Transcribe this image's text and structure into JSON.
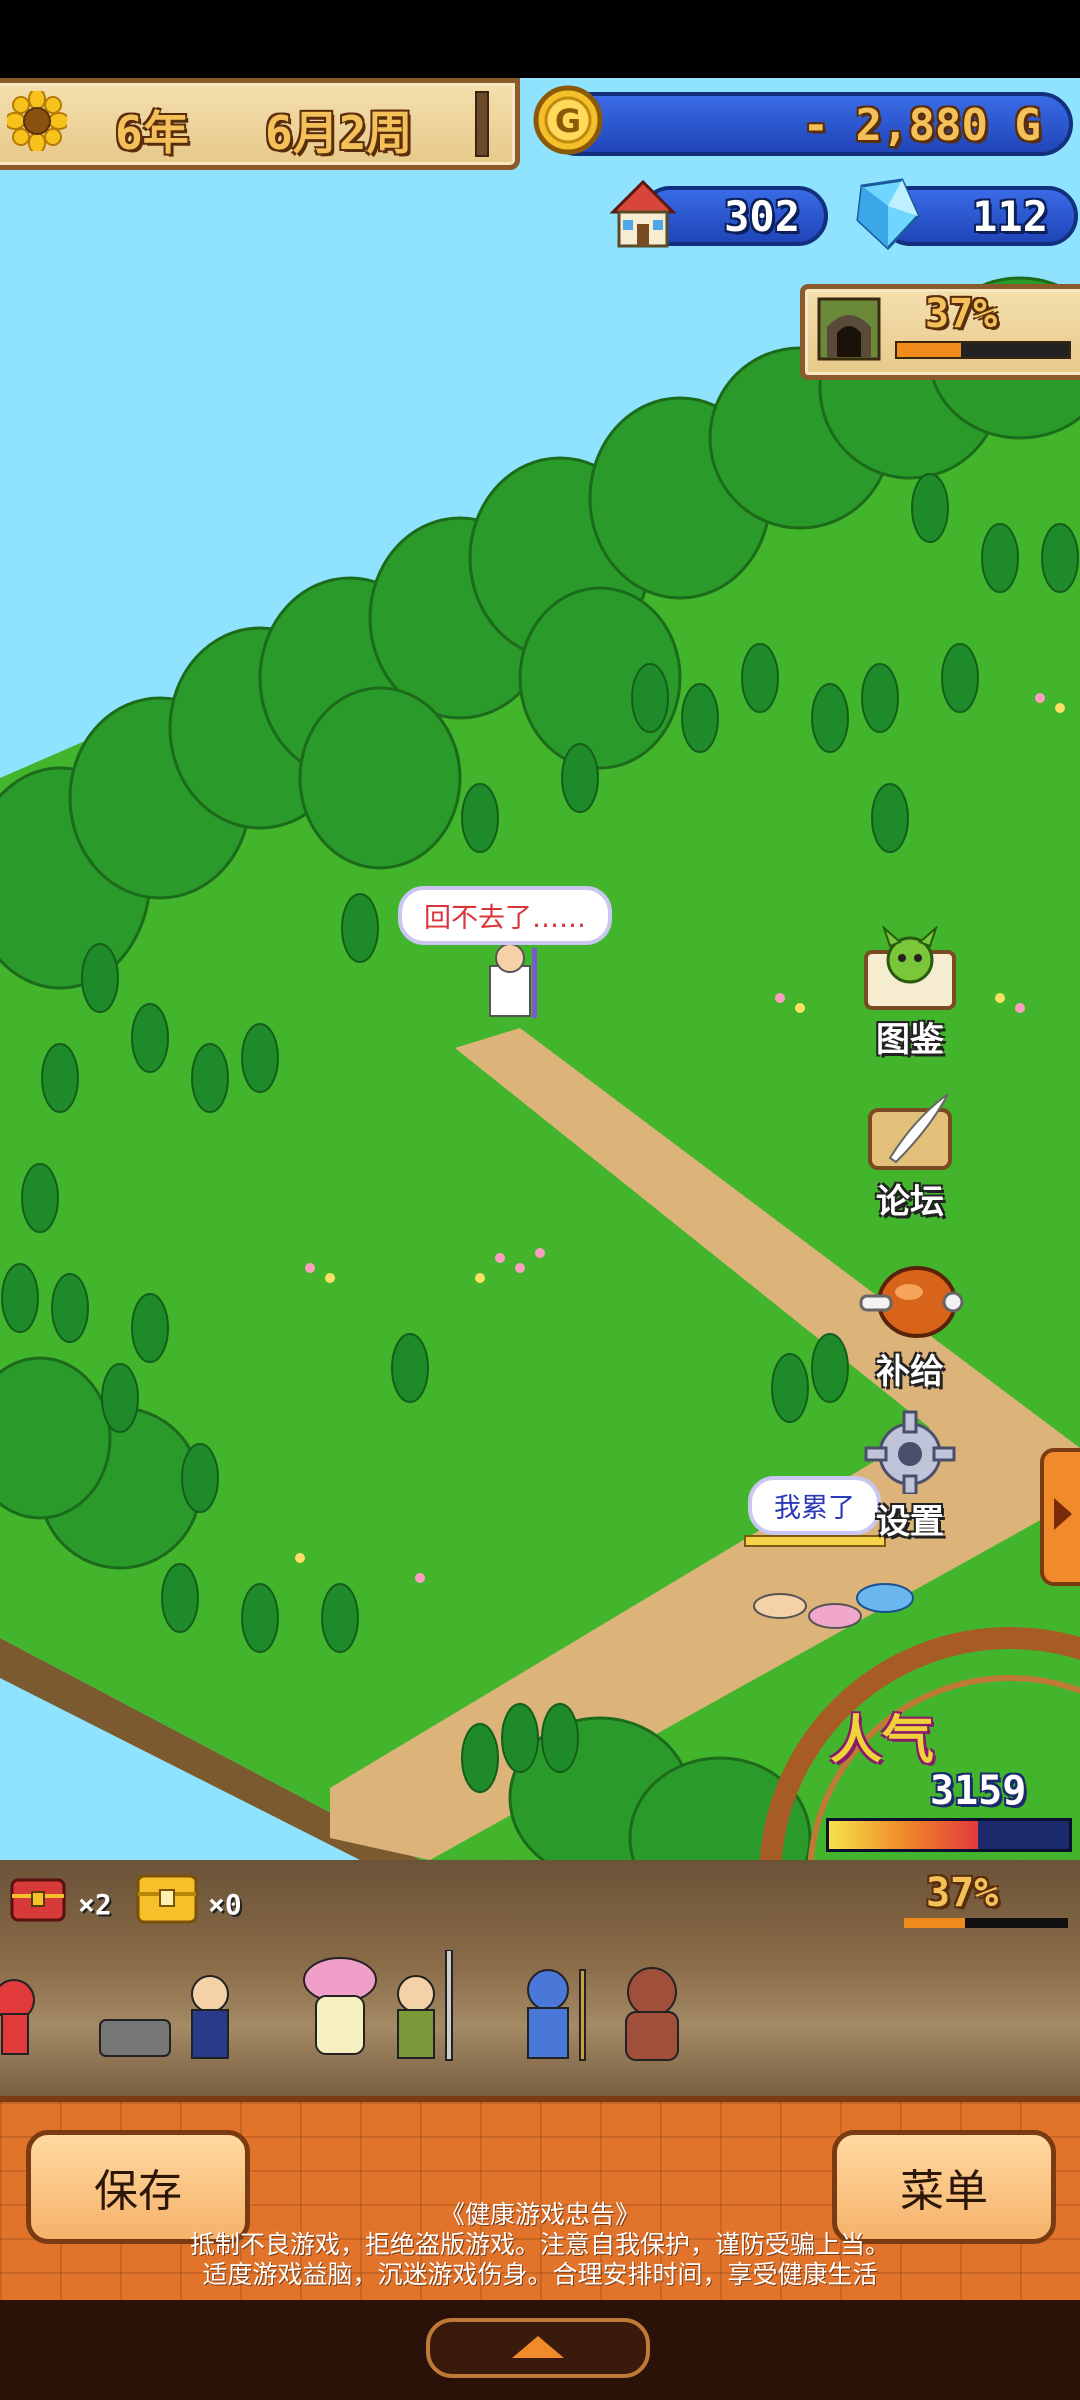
{
  "hud": {
    "date": {
      "year": "6年",
      "month_week": "6月2周"
    },
    "money": "- 2,880 G",
    "population": "302",
    "crystals": "112",
    "dungeon_progress": "37%"
  },
  "map": {
    "bubble_1": "回不去了……",
    "bubble_2": "我累了"
  },
  "side_menu": {
    "encyclopedia": "图鉴",
    "forum": "论坛",
    "supply": "补给",
    "settings": "设置"
  },
  "popularity": {
    "label": "人气",
    "value": "3159",
    "level": 0.62
  },
  "party_strip": {
    "chest_red_count": "×2",
    "chest_gold_count": "×0",
    "progress": "37%"
  },
  "bottom_panel": {
    "save_label": "保存",
    "menu_label": "菜单",
    "notice_title": "《健康游戏忠告》",
    "notice_line1": "抵制不良游戏，拒绝盗版游戏。注意自我保护，谨防受骗上当。",
    "notice_line2": "适度游戏益脑，沉迷游戏伤身。合理安排时间，享受健康生活"
  },
  "colors": {
    "sky": "#8fe3ff",
    "grass": "#43b52c",
    "path": "#dcb47a",
    "panel_orange": "#e2732a",
    "hud_blue": "#2b57d0"
  }
}
